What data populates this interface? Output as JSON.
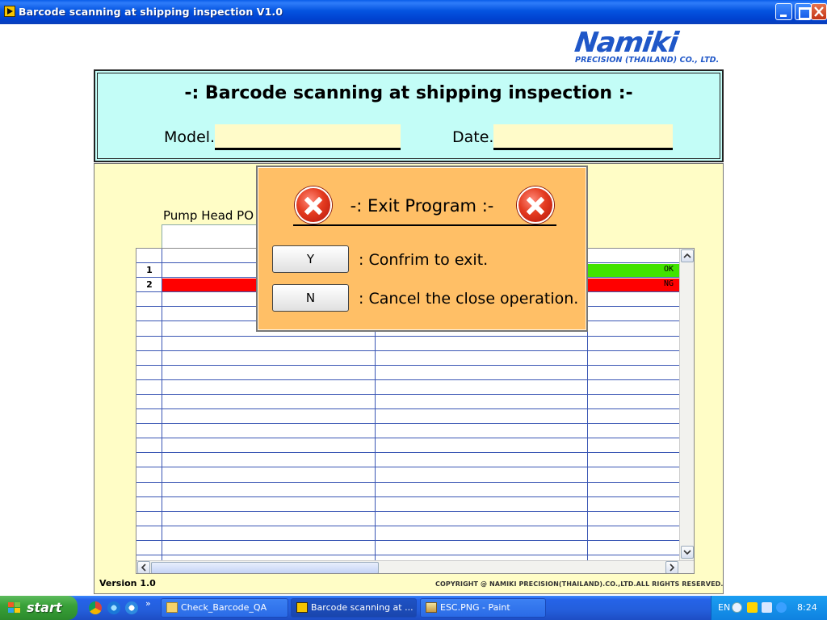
{
  "window": {
    "title": "Barcode scanning at shipping inspection V1.0"
  },
  "logo": {
    "brand": "Namiki",
    "subtitle": "PRECISION (THAILAND) CO., LTD."
  },
  "header": {
    "title": "-: Barcode scanning at shipping inspection :-",
    "model_label": "Model.",
    "model_value": "",
    "date_label": "Date.",
    "date_value": ""
  },
  "main": {
    "pump_head_label": "Pump Head PO",
    "pump_head_value": "",
    "grid": {
      "rows": [
        {
          "num": "1",
          "status": "OK",
          "status_color": "#41e300"
        },
        {
          "num": "2",
          "status": "NG",
          "status_color": "#ff0000"
        }
      ]
    },
    "version": "Version 1.0",
    "copyright": "COPYRIGHT @    NAMIKI PRECISION(THAILAND).CO.,LTD.ALL RIGHTS RESERVED."
  },
  "dialog": {
    "title": "-: Exit Program :-",
    "yes_button": "Y",
    "yes_text": ": Confrim to exit.",
    "no_button": "N",
    "no_text": ": Cancel the close operation."
  },
  "taskbar": {
    "start_label": "start",
    "quick_launch": [
      "chrome-icon",
      "ie-icon",
      "ie-alt-icon"
    ],
    "chevron": "»",
    "tasks": [
      {
        "label": "Check_Barcode_QA",
        "icon": "folder-icon"
      },
      {
        "label": "Barcode scanning at ...",
        "icon": "labview-icon",
        "active": true
      },
      {
        "label": "ESC.PNG - Paint",
        "icon": "paint-icon"
      }
    ],
    "tray": {
      "language": "EN",
      "time": "8:24"
    }
  },
  "colors": {
    "header_bg": "#c3fdf7",
    "main_bg": "#fffdc6",
    "field_bg": "#fffbc9",
    "dialog_bg": "#ffbf66",
    "ok_green": "#41e300",
    "ng_red": "#ff0000",
    "grid_line": "#3a56b4",
    "brand_blue": "#1f57c8"
  }
}
